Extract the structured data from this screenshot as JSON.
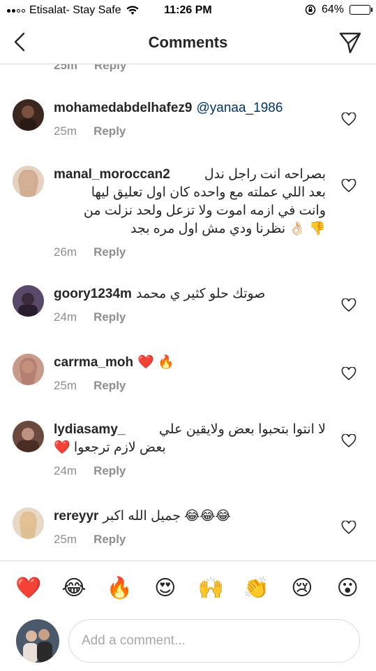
{
  "status_bar": {
    "carrier": "Etisalat- Stay Safe",
    "time": "11:26 PM",
    "battery": "64%",
    "battery_level": 0.64
  },
  "nav": {
    "title": "Comments"
  },
  "partial_comment": {
    "time": "25m",
    "reply": "Reply"
  },
  "comments": [
    {
      "username": "mohamedabdelhafez9",
      "mention": "@yanaa_1986",
      "text": "",
      "time": "25m",
      "reply": "Reply",
      "avatar_color": "#5a3a2a"
    },
    {
      "username": "manal_moroccan2",
      "text_lines": [
        "بصراحه انت راجل ندل",
        "بعد اللي عملته مع واحده كان اول تعليق ليها",
        "وانت في ازمه اموت ولا تزعل ولحد نزلت من",
        "👎 👌🏻 نظرنا ودي مش اول مره بجد"
      ],
      "time": "26m",
      "reply": "Reply",
      "avatar_color": "#c9a58a"
    },
    {
      "username": "goory1234m",
      "text": "صوتك حلو كثير ي محمد",
      "time": "24m",
      "reply": "Reply",
      "avatar_color": "#4a3a5a"
    },
    {
      "username": "carrma_moh",
      "text": "❤️ 🔥",
      "time": "25m",
      "reply": "Reply",
      "avatar_color": "#b88a7a"
    },
    {
      "username": "lydiasamy_",
      "text_lines": [
        "لا انتوا بتحبوا بعض ولايقين علي",
        "بعض لازم ترجعوا ❤️"
      ],
      "time": "24m",
      "reply": "Reply",
      "avatar_color": "#6a4a3a"
    },
    {
      "username": "rereyyr",
      "text": "جميل الله اكبر 😂😂😂",
      "time": "25m",
      "reply": "Reply",
      "avatar_color": "#d8b89a"
    }
  ],
  "emoji_bar": [
    "❤️",
    "😂",
    "🔥",
    "😍",
    "🙌",
    "👏",
    "😢",
    "😮"
  ],
  "compose": {
    "placeholder": "Add a comment..."
  }
}
